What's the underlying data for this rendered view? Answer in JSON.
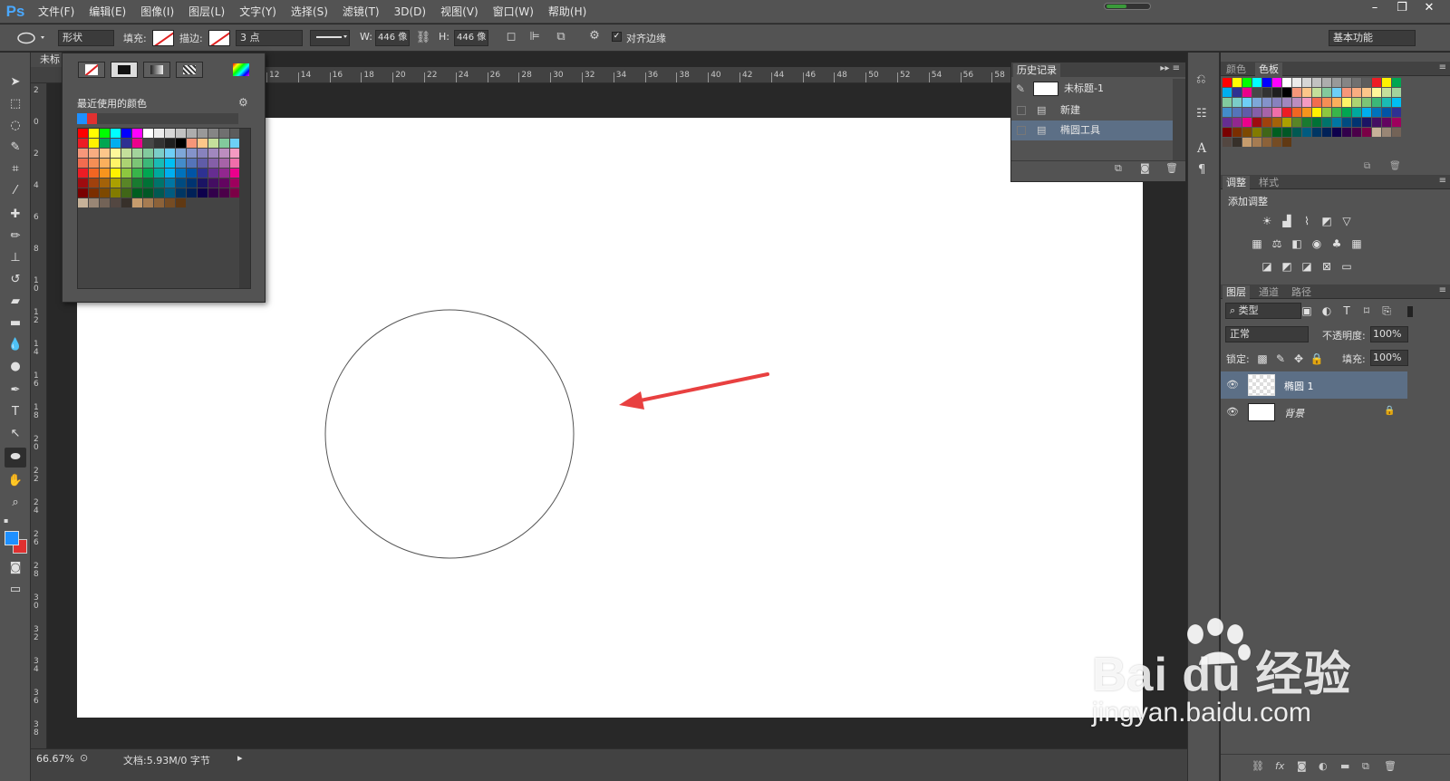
{
  "app": {
    "logo": "Ps"
  },
  "menu": [
    "文件(F)",
    "编辑(E)",
    "图像(I)",
    "图层(L)",
    "文字(Y)",
    "选择(S)",
    "滤镜(T)",
    "3D(D)",
    "视图(V)",
    "窗口(W)",
    "帮助(H)"
  ],
  "window_controls": {
    "minimize": "–",
    "restore": "❐",
    "close": "✕"
  },
  "options": {
    "mode_value": "形状",
    "fill_label": "填充:",
    "stroke_label": "描边:",
    "stroke_size": "3 点",
    "w_label": "W:",
    "w_value": "446 像",
    "h_label": "H:",
    "h_value": "446 像",
    "align_edges_label": "对齐边缘",
    "workspace": "基本功能"
  },
  "document": {
    "tab_title": "未标"
  },
  "ruler": {
    "top_ticks": [
      "12",
      "14",
      "16",
      "18",
      "20",
      "22",
      "24",
      "26",
      "28",
      "30",
      "32",
      "34",
      "36",
      "38",
      "40",
      "42",
      "44",
      "46",
      "48",
      "50",
      "52",
      "54",
      "56",
      "58"
    ],
    "left_ticks": [
      "2",
      "0",
      "2",
      "4",
      "6",
      "8",
      "10",
      "12",
      "14",
      "16",
      "18",
      "20",
      "22",
      "24",
      "26",
      "28",
      "30",
      "32",
      "34",
      "36",
      "38"
    ]
  },
  "color_picker": {
    "title": "最近使用的颜色",
    "recent_colors": [
      "#1e90ff",
      "#e03030"
    ]
  },
  "swatch_colors": [
    "#ff0000",
    "#ffff00",
    "#00ff00",
    "#00ffff",
    "#0000ff",
    "#ff00ff",
    "#ffffff",
    "#ebebeb",
    "#d6d6d6",
    "#c2c2c2",
    "#adadad",
    "#999999",
    "#858585",
    "#707070",
    "#5c5c5c",
    "#ed1c24",
    "#fff200",
    "#00a651",
    "#00aeef",
    "#2e3192",
    "#ec008c",
    "#474747",
    "#333333",
    "#1f1f1f",
    "#000000",
    "#f69679",
    "#fdc689",
    "#c4df9b",
    "#82ca9c",
    "#6dcff6",
    "#f7977a",
    "#f9ad81",
    "#fdc68a",
    "#fff79a",
    "#c4df9b",
    "#a3d39c",
    "#82ca9d",
    "#7bcdc8",
    "#6ecff6",
    "#7ea7d8",
    "#8493ca",
    "#8882be",
    "#a187be",
    "#bc8dbf",
    "#f49ac2",
    "#f26c4f",
    "#f68e55",
    "#fbaf5c",
    "#fff467",
    "#acd372",
    "#7cc576",
    "#3bb878",
    "#1abbb4",
    "#00bff3",
    "#438cca",
    "#5574b9",
    "#605ca8",
    "#855fa8",
    "#a763a8",
    "#f06eaa",
    "#ed1c24",
    "#f26522",
    "#f7941d",
    "#fff200",
    "#8dc73f",
    "#39b54a",
    "#00a651",
    "#00a99d",
    "#00aeef",
    "#0072bc",
    "#0054a6",
    "#2e3192",
    "#662d91",
    "#92278f",
    "#ec008c",
    "#9e0b0f",
    "#a0410d",
    "#a36209",
    "#aba000",
    "#598527",
    "#197b30",
    "#007236",
    "#00746b",
    "#0076a3",
    "#004b80",
    "#003471",
    "#1b1464",
    "#440e62",
    "#630460",
    "#9e005d",
    "#790000",
    "#7b2e00",
    "#7d4900",
    "#827b00",
    "#406618",
    "#005e20",
    "#005826",
    "#005952",
    "#005b7f",
    "#003663",
    "#002157",
    "#0d004c",
    "#32004b",
    "#4b0049",
    "#7b0046",
    "#c7b299",
    "#998675",
    "#736357",
    "#534741",
    "#37302a",
    "#c69c6d",
    "#a67c52",
    "#8c6239",
    "#754c24",
    "#603913"
  ],
  "history": {
    "tab": "历史记录",
    "snapshot": "未标题-1",
    "items": [
      "新建",
      "椭圆工具"
    ]
  },
  "right_panels": {
    "color_tabs": [
      "颜色",
      "色板"
    ],
    "adjust_tabs": [
      "调整",
      "样式"
    ],
    "adjust_title": "添加调整",
    "layers_tabs": [
      "图层",
      "通道",
      "路径"
    ],
    "filter_kind": "类型",
    "blend_mode": "正常",
    "opacity_label": "不透明度:",
    "opacity_value": "100%",
    "lock_label": "锁定:",
    "fill_label": "填充:",
    "fill_value": "100%",
    "layers": [
      {
        "name": "椭圆 1",
        "selected": true
      },
      {
        "name": "背景",
        "selected": false
      }
    ]
  },
  "status": {
    "zoom": "66.67%",
    "doc_info": "文档:5.93M/0 字节"
  },
  "watermark": {
    "brand": "Bai  du 经验",
    "url": "jingyan.baidu.com"
  },
  "colors": {
    "foreground": "#1e90ff",
    "background": "#e03030",
    "annotation_arrow": "#e84040",
    "selection": "#5c6f86"
  }
}
